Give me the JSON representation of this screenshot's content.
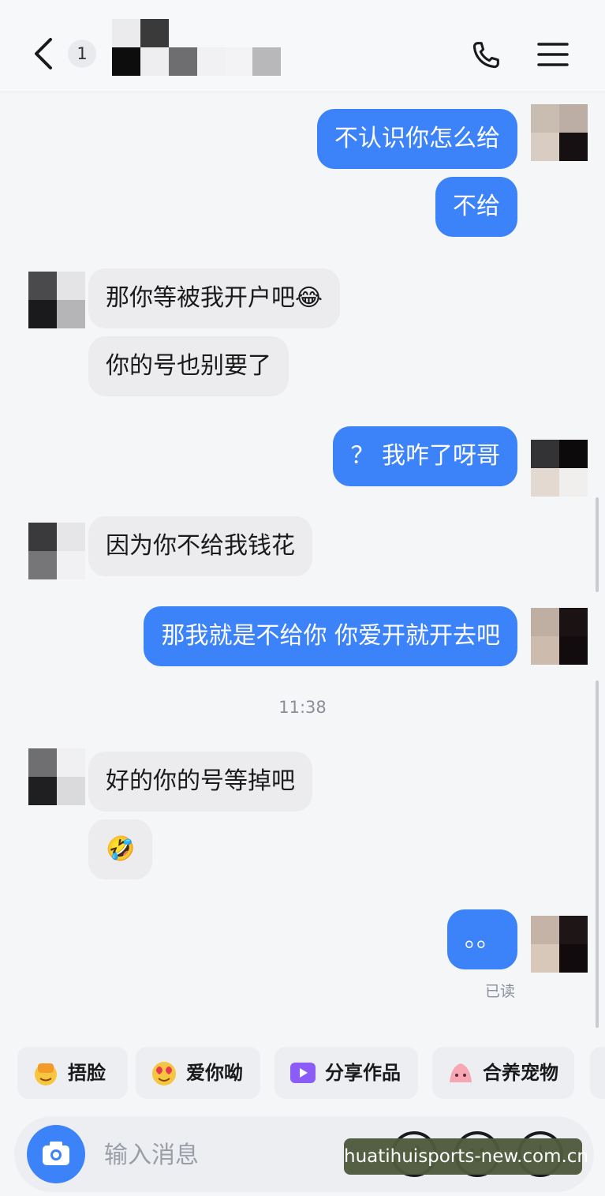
{
  "header": {
    "back_icon": "chevron-left-icon",
    "unread_count": "1",
    "phone_icon": "phone-icon",
    "menu_icon": "hamburger-menu-icon"
  },
  "messages": [
    {
      "side": "out",
      "text": "不认识你怎么给"
    },
    {
      "side": "out",
      "text": "不给"
    },
    {
      "side": "in",
      "text": "那你等被我开户吧😂"
    },
    {
      "side": "in",
      "text": "你的号也别要了"
    },
    {
      "side": "out",
      "text": "？ 我咋了呀哥"
    },
    {
      "side": "in",
      "text": "因为你不给我钱花"
    },
    {
      "side": "out",
      "text": "那我就是不给你 你爱开就开去吧"
    },
    {
      "side": "in",
      "text": "好的你的号等掉吧"
    },
    {
      "side": "in",
      "text": "🤣"
    },
    {
      "side": "out",
      "text": "。。"
    }
  ],
  "timestamp": "11:38",
  "read_status": "已读",
  "quick_replies": [
    {
      "label": "捂脸",
      "icon": "facepalm-emoji-icon"
    },
    {
      "label": "爱你呦",
      "icon": "heart-eyes-emoji-icon"
    },
    {
      "label": "分享作品",
      "icon": "video-share-icon"
    },
    {
      "label": "合养宠物",
      "icon": "pet-icon"
    }
  ],
  "composer": {
    "placeholder": "输入消息",
    "camera_icon": "camera-icon",
    "voice_icon": "voice-icon",
    "emoji_icon": "emoji-icon",
    "plus_icon": "plus-icon"
  },
  "watermark": "huatihuisports-new.com.cn",
  "colors": {
    "accent": "#3c82f8",
    "incoming_bubble": "#ececef",
    "background": "#f5f6f8"
  }
}
